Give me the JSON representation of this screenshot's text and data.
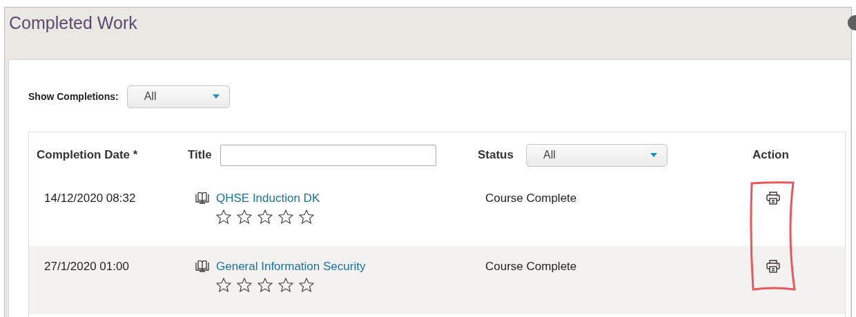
{
  "header": {
    "title": "Completed Work"
  },
  "filter": {
    "label": "Show Completions:",
    "value": "All"
  },
  "table": {
    "columns": [
      {
        "kind": "text",
        "label": "Completion Date *"
      },
      {
        "kind": "title-filter",
        "label": "Title"
      },
      {
        "kind": "status-filter",
        "label": "Status",
        "value": "All"
      },
      {
        "kind": "text",
        "label": "Action"
      }
    ],
    "rows": [
      {
        "date": "14/12/2020 08:32",
        "title": "QHSE Induction DK",
        "stars": 0,
        "status": "Course Complete"
      },
      {
        "date": "27/1/2020 01:00",
        "title": "General Information Security",
        "stars": 0,
        "status": "Course Complete"
      }
    ]
  }
}
